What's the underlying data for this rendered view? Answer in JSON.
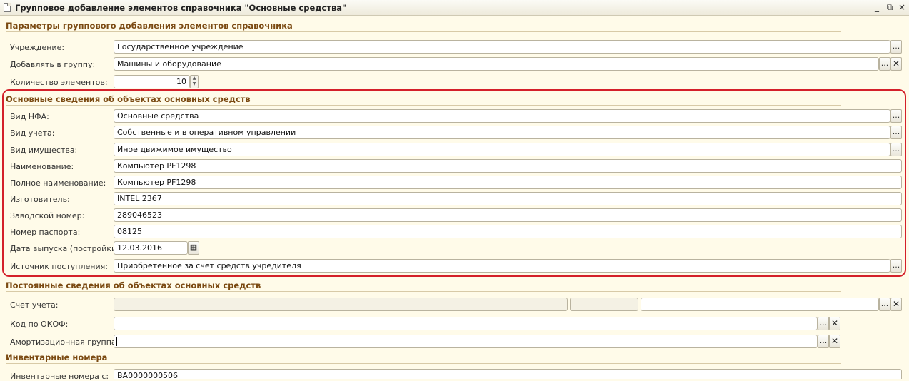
{
  "window": {
    "title": "Групповое добавление элементов справочника \"Основные средства\"",
    "controls": [
      "_",
      "⧉",
      "×"
    ]
  },
  "sections": {
    "params": "Параметры группового добавления элементов справочника",
    "basic": "Основные сведения об объектах основных средств",
    "constant": "Постоянные сведения об объектах основных средств",
    "inventory": "Инвентарные номера"
  },
  "params": {
    "institution_label": "Учреждение:",
    "institution_value": "Государственное учреждение",
    "group_label": "Добавлять в группу:",
    "group_value": "Машины и оборудование",
    "count_label": "Количество элементов:",
    "count_value": "10"
  },
  "basic": {
    "nfa_label": "Вид НФА:",
    "nfa_value": "Основные средства",
    "accounting_label": "Вид учета:",
    "accounting_value": "Собственные и в оперативном управлении",
    "property_label": "Вид имущества:",
    "property_value": "Иное движимое имущество",
    "name_label": "Наименование:",
    "name_value": "Компьютер PF1298",
    "fullname_label": "Полное наименование:",
    "fullname_value": "Компьютер PF1298",
    "maker_label": "Изготовитель:",
    "maker_value": "INTEL 2367",
    "serial_label": "Заводской номер:",
    "serial_value": "289046523",
    "passport_label": "Номер паспорта:",
    "passport_value": "08125",
    "date_label": "Дата выпуска (постройки):",
    "date_value": "12.03.2016",
    "source_label": "Источник поступления:",
    "source_value": "Приобретенное за счет средств учредителя"
  },
  "constant": {
    "account_label": "Счет учета:",
    "okof_label": "Код по ОКОФ:",
    "amort_label": "Амортизационная группа:"
  },
  "inventory": {
    "from_label": "Инвентарные номера с:",
    "from_value": "ВА0000000506"
  },
  "buttons": {
    "select": "...",
    "clear": "✕",
    "calendar": "▦",
    "up": "▲",
    "down": "▼"
  }
}
